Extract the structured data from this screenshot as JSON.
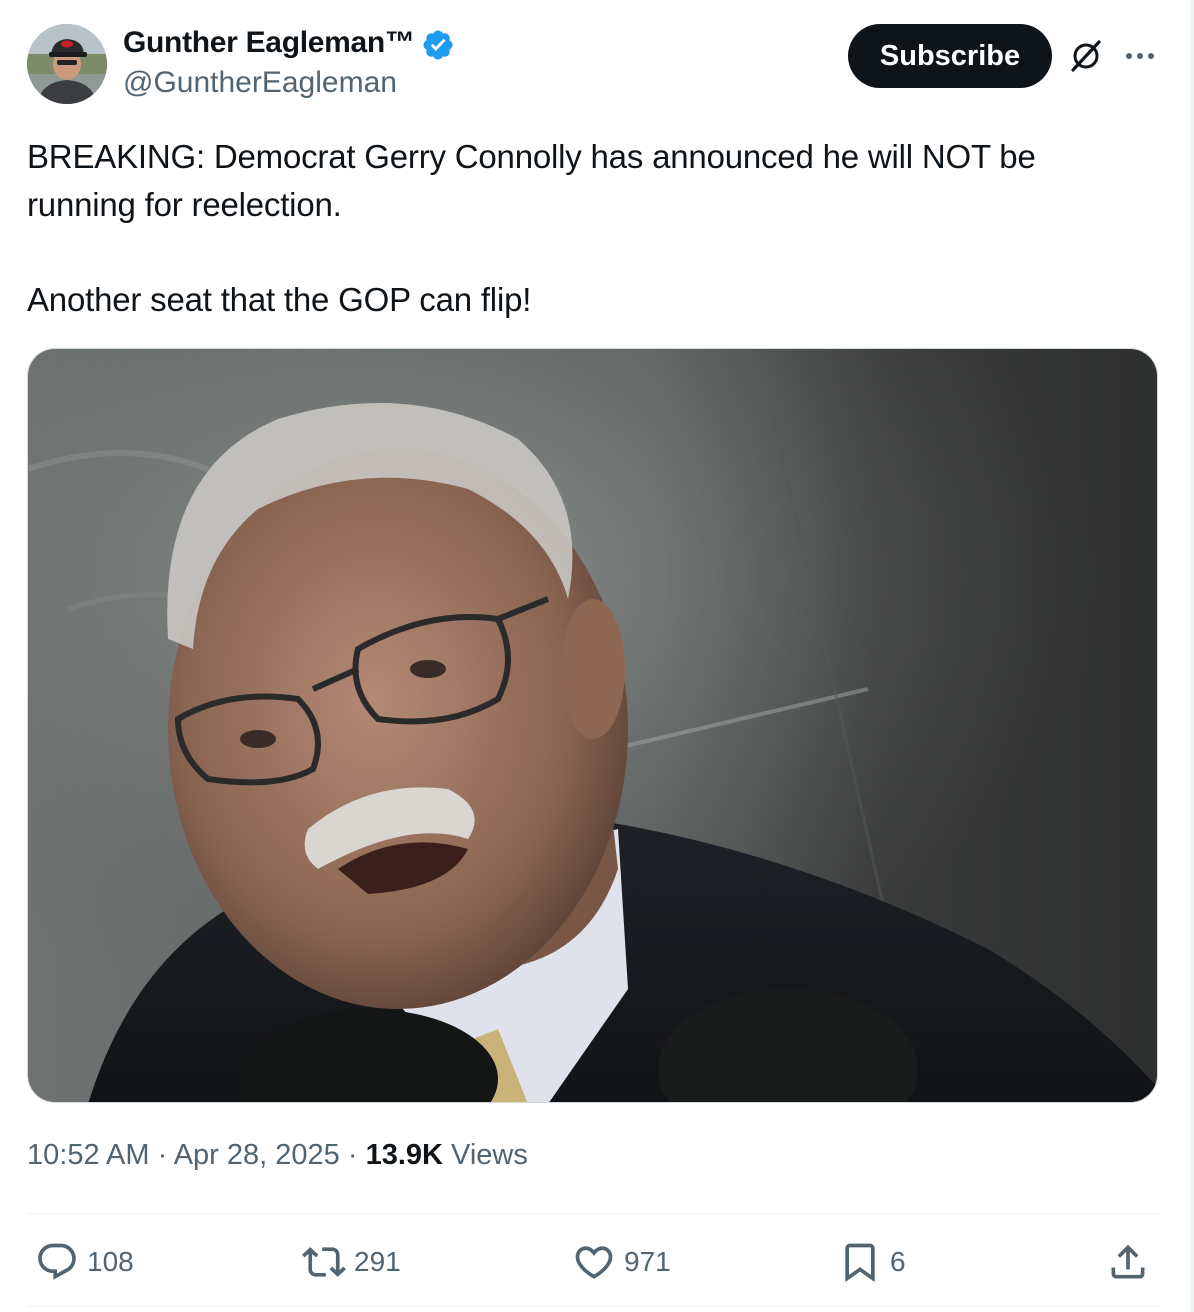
{
  "author": {
    "display_name": "Gunther Eagleman™",
    "handle": "@GuntherEagleman",
    "verified": true,
    "verified_color": "#1d9bf0"
  },
  "header": {
    "subscribe_label": "Subscribe",
    "grok_icon": "grok-icon",
    "more_icon": "more-icon"
  },
  "tweet": {
    "line_1": "BREAKING: Democrat Gerry Connolly has announced he will NOT be running for reelection.",
    "line_2": "Another seat that the GOP can flip!"
  },
  "meta": {
    "time": "10:52 AM",
    "separator_1": " · ",
    "date": "Apr 28, 2025",
    "separator_2": " · ",
    "views_count": "13.9K",
    "views_label": " Views"
  },
  "actions": {
    "replies": "108",
    "reposts": "291",
    "likes": "971",
    "bookmarks": "6"
  },
  "colors": {
    "text": "#0f1419",
    "secondary": "#536471",
    "border": "#eff3f4"
  }
}
